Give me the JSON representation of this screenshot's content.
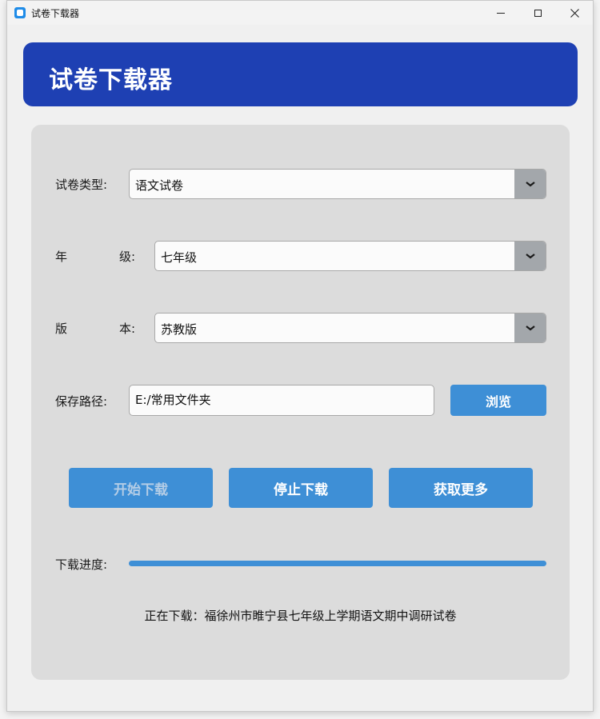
{
  "window": {
    "title": "试卷下载器"
  },
  "header": {
    "title": "试卷下载器"
  },
  "form": {
    "paper_type": {
      "label": "试卷类型:",
      "value": "语文试卷"
    },
    "grade": {
      "label_left": "年",
      "label_right": "级:",
      "value": "七年级"
    },
    "edition": {
      "label_left": "版",
      "label_right": "本:",
      "value": "苏教版"
    },
    "save_path": {
      "label": "保存路径:",
      "value": "E:/常用文件夹"
    },
    "browse_label": "浏览"
  },
  "actions": {
    "start_label": "开始下载",
    "stop_label": "停止下载",
    "more_label": "获取更多"
  },
  "progress": {
    "label": "下载进度:",
    "value": 1.0
  },
  "status": {
    "text": "正在下载：福徐州市睢宁县七年级上学期语文期中调研试卷"
  },
  "colors": {
    "header": "#1e40b3",
    "button": "#3e8fd6",
    "panel": "#dcdcdc"
  }
}
